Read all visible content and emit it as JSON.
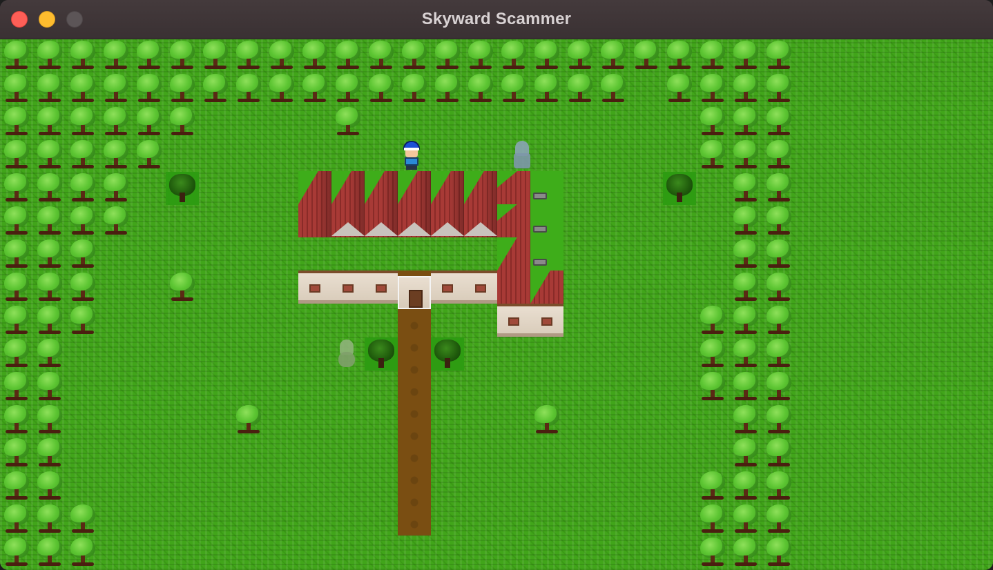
{
  "window": {
    "title": "Skyward Scammer"
  },
  "controls": {
    "close_icon": "close-icon",
    "minimize_icon": "minimize-icon",
    "maximize_icon": "maximize-icon"
  },
  "colors": {
    "grass": "#41a51a",
    "path": "#7a4e12",
    "roof": "#a83a36",
    "titlebar": "#3d3335"
  },
  "scene": {
    "player": "player-character",
    "npcs": [
      "ghost-npc",
      "green-npc"
    ],
    "buildings": [
      "row-houses",
      "side-house"
    ],
    "selected_tile": "house-door"
  }
}
